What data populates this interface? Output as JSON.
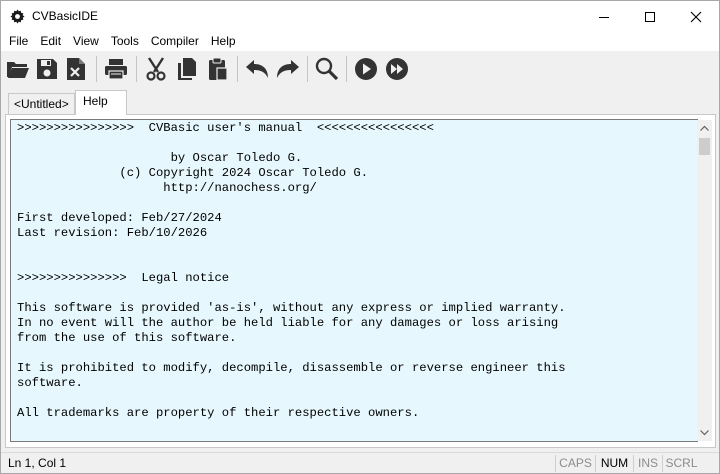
{
  "window": {
    "title": "CVBasicIDE",
    "controls": {
      "minimize_icon": "minimize-icon",
      "maximize_icon": "maximize-icon",
      "close_icon": "close-icon"
    }
  },
  "menu": [
    "File",
    "Edit",
    "View",
    "Tools",
    "Compiler",
    "Help"
  ],
  "toolbar": {
    "buttons": [
      "open-folder-icon",
      "save-icon",
      "close-file-icon",
      "print-icon",
      "cut-icon",
      "copy-icon",
      "paste-icon",
      "undo-icon",
      "redo-icon",
      "find-icon",
      "run-icon",
      "fast-forward-icon"
    ]
  },
  "tabs": {
    "untitled": "<Untitled>",
    "help": "Help",
    "active": "Help"
  },
  "editor": {
    "background": "#e6f7fd",
    "lines": [
      ">>>>>>>>>>>>>>>>  CVBasic user's manual  <<<<<<<<<<<<<<<<",
      "",
      "                     by Oscar Toledo G.",
      "              (c) Copyright 2024 Oscar Toledo G.",
      "                    http://nanochess.org/",
      "",
      "First developed: Feb/27/2024",
      "Last revision: Feb/10/2026",
      "",
      "",
      ">>>>>>>>>>>>>>>  Legal notice",
      "",
      "This software is provided 'as-is', without any express or implied warranty.",
      "In no event will the author be held liable for any damages or loss arising",
      "from the use of this software.",
      "",
      "It is prohibited to modify, decompile, disassemble or reverse engineer this",
      "software.",
      "",
      "All trademarks are property of their respective owners."
    ]
  },
  "status": {
    "position": "Ln 1, Col 1",
    "caps": "CAPS",
    "num": "NUM",
    "ins": "INS",
    "scrl": "SCRL",
    "num_active": true
  }
}
